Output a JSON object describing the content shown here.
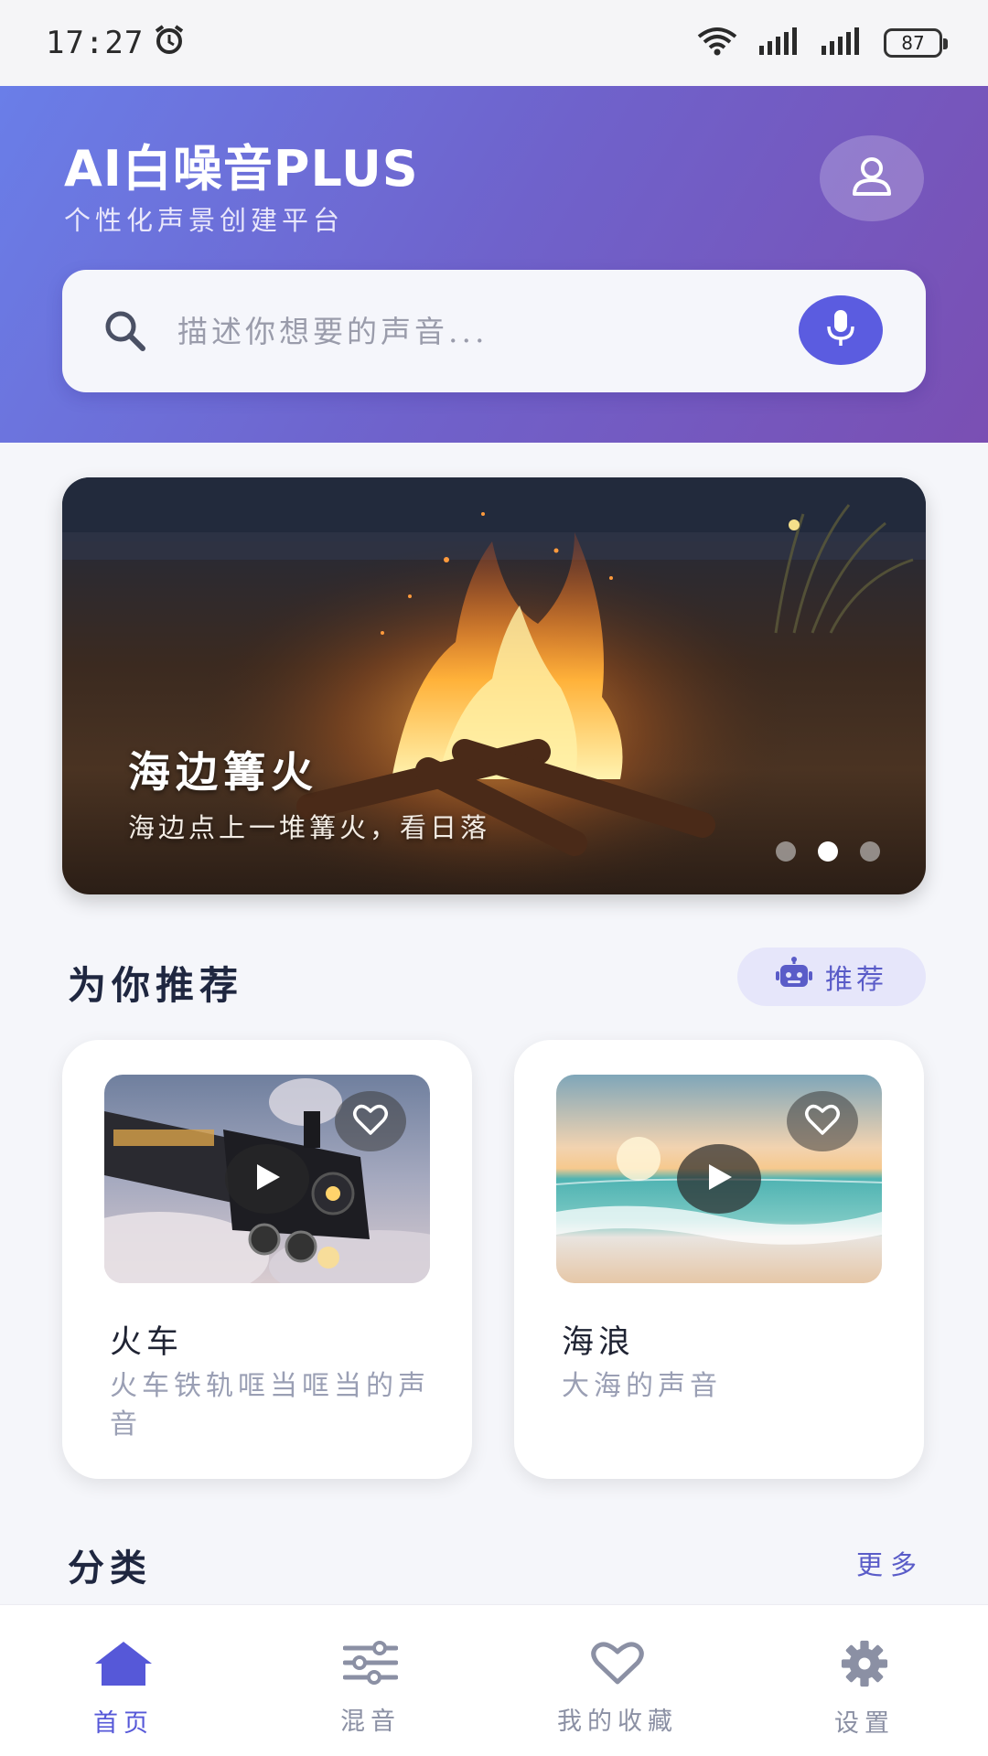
{
  "status_bar": {
    "time": "17:27",
    "battery": "87"
  },
  "header": {
    "title": "AI白噪音PLUS",
    "subtitle": "个性化声景创建平台"
  },
  "search": {
    "placeholder": "描述你想要的声音..."
  },
  "banner": {
    "title": "海边篝火",
    "subtitle": "海边点上一堆篝火，看日落",
    "active_slide": 2,
    "slide_count": 3
  },
  "recommend": {
    "section_title": "为你推荐",
    "chip_label": "推荐",
    "cards": [
      {
        "title": "火车",
        "description": "火车铁轨哐当哐当的声音"
      },
      {
        "title": "海浪",
        "description": "大海的声音"
      }
    ]
  },
  "category": {
    "section_title": "分类",
    "more_label": "更多"
  },
  "nav": {
    "items": [
      {
        "label": "首页"
      },
      {
        "label": "混音"
      },
      {
        "label": "我的收藏"
      },
      {
        "label": "设置"
      }
    ]
  },
  "colors": {
    "accent": "#5b5ce0",
    "header_gradient_start": "#6a7ee8",
    "header_gradient_end": "#7a4fb3"
  }
}
